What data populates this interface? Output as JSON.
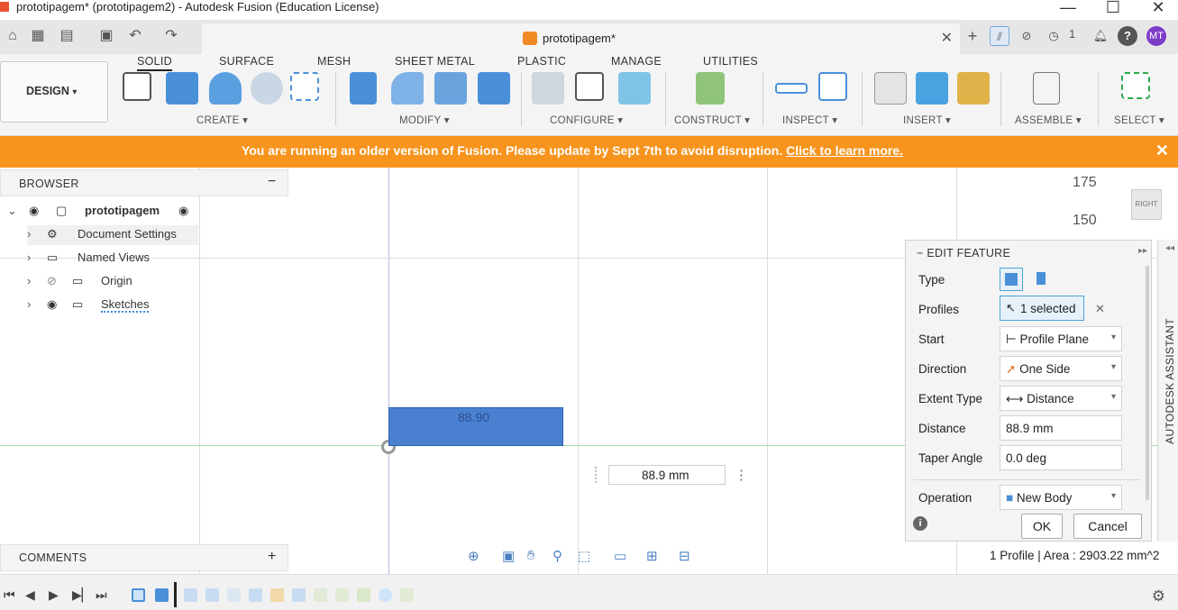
{
  "window": {
    "title": "prototipagem* (prototipagem2) - Autodesk Fusion (Education License)",
    "controls": [
      "—",
      "☐",
      "✕"
    ]
  },
  "document_tab": {
    "name": "prototipagem*",
    "close": "✕"
  },
  "top_right": {
    "jobs_count": "1",
    "user_initials": "MT"
  },
  "ribbon": {
    "tabs": [
      "SOLID",
      "SURFACE",
      "MESH",
      "SHEET METAL",
      "PLASTIC",
      "MANAGE",
      "UTILITIES"
    ],
    "active_tab": "SOLID",
    "workspace": "DESIGN",
    "workspace_caret": "▾",
    "groups": [
      "CREATE ▾",
      "MODIFY ▾",
      "CONFIGURE ▾",
      "CONSTRUCT ▾",
      "INSPECT ▾",
      "INSERT ▾",
      "ASSEMBLE ▾",
      "SELECT ▾"
    ]
  },
  "banner": {
    "message": "You are running an older version of Fusion. Please update by Sept 7th to avoid disruption.",
    "link": "Click to learn more.",
    "close": "✕"
  },
  "browser": {
    "title": "BROWSER",
    "collapse": "−",
    "root": "prototipagem",
    "items": [
      "Document Settings",
      "Named Views",
      "Origin",
      "Sketches"
    ]
  },
  "viewport": {
    "scale_labels": [
      "175",
      "150"
    ],
    "viewcube_label": "RIGHT",
    "sketch_dimension": "88.90",
    "distance_input": "88.9 mm",
    "distance_menu": "⋮"
  },
  "edit_feature": {
    "title": "EDIT FEATURE",
    "rows": [
      {
        "label": "Type",
        "value": ""
      },
      {
        "label": "Profiles",
        "value": "1 selected"
      },
      {
        "label": "Start",
        "value": "Profile Plane"
      },
      {
        "label": "Direction",
        "value": "One Side"
      },
      {
        "label": "Extent Type",
        "value": "Distance"
      },
      {
        "label": "Distance",
        "value": "88.9 mm"
      },
      {
        "label": "Taper Angle",
        "value": "0.0 deg"
      },
      {
        "label": "Operation",
        "value": "New Body"
      }
    ],
    "clear_profiles": "✕",
    "ok": "OK",
    "cancel": "Cancel"
  },
  "assistant": {
    "label": "AUTODESK ASSISTANT"
  },
  "comments": {
    "title": "COMMENTS",
    "add": "+"
  },
  "status": {
    "text": "1 Profile | Area : 2903.22 mm^2"
  },
  "colors": {
    "banner": "#f7941d",
    "accent_blue": "#4a80d0",
    "ok_border": "#4aa3d8"
  }
}
